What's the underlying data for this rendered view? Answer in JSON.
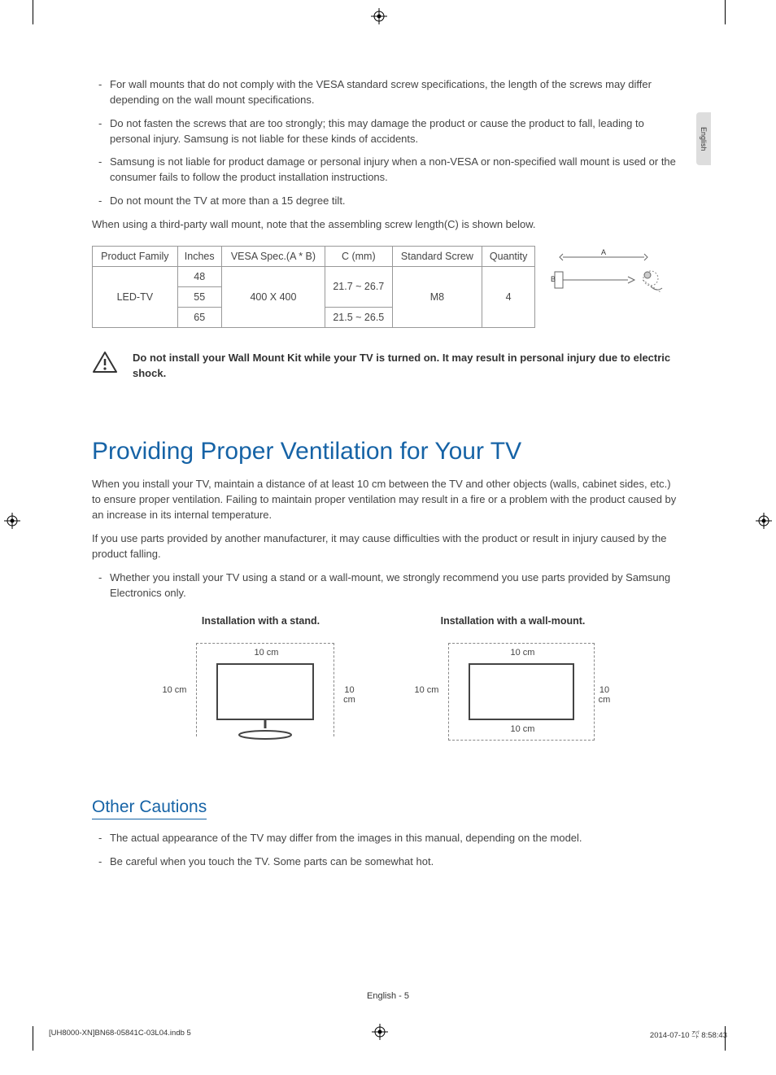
{
  "lang_tab": "English",
  "top_bullets": [
    "For wall mounts that do not comply with the VESA standard screw specifications, the length of the screws may differ depending on the wall mount specifications.",
    "Do not fasten the screws that are too strongly; this may damage the product or cause the product to fall, leading to personal injury. Samsung is not liable for these kinds of accidents.",
    "Samsung is not liable for product damage or personal injury when a non-VESA or non-specified wall mount is used or the consumer fails to follow the product installation instructions.",
    "Do not mount the TV at more than a 15 degree tilt."
  ],
  "third_party_note": "When using a third-party wall mount, note that the assembling screw length(C) is shown below.",
  "table": {
    "headers": [
      "Product Family",
      "Inches",
      "VESA Spec.(A * B)",
      "C (mm)",
      "Standard Screw",
      "Quantity"
    ],
    "family": "LED-TV",
    "inches": [
      "48",
      "55",
      "65"
    ],
    "vesa": "400 X 400",
    "c_mm": [
      "21.7 ~ 26.7",
      "21.5 ~ 26.5"
    ],
    "screw": "M8",
    "qty": "4"
  },
  "screw_labels": {
    "a": "A",
    "b": "B"
  },
  "warning": "Do not install your Wall Mount Kit while your TV is turned on. It may result in personal injury due to electric shock.",
  "vent_heading": "Providing Proper Ventilation for Your TV",
  "vent_p1": "When you install your TV, maintain a distance of at least 10 cm between the TV and other objects (walls, cabinet sides, etc.) to ensure proper ventilation. Failing to maintain proper ventilation may result in a fire or a problem with the product caused by an increase in its internal temperature.",
  "vent_p2": "If you use parts provided by another manufacturer, it may cause difficulties with the product or result in injury caused by the product falling.",
  "vent_bullets": [
    "Whether you install your TV using a stand or a wall-mount, we strongly recommend you use parts provided by Samsung Electronics only."
  ],
  "install_stand_caption": "Installation with a stand.",
  "install_wall_caption": "Installation with a wall-mount.",
  "dim_10cm": "10 cm",
  "other_heading": "Other Cautions",
  "other_bullets": [
    "The actual appearance of the TV may differ from the images in this manual, depending on the model.",
    "Be careful when you touch the TV. Some parts can be somewhat hot."
  ],
  "footer_page": "English - 5",
  "footer_left": "[UH8000-XN]BN68-05841C-03L04.indb   5",
  "footer_right": "2014-07-10   ㌀ 8:58:43"
}
